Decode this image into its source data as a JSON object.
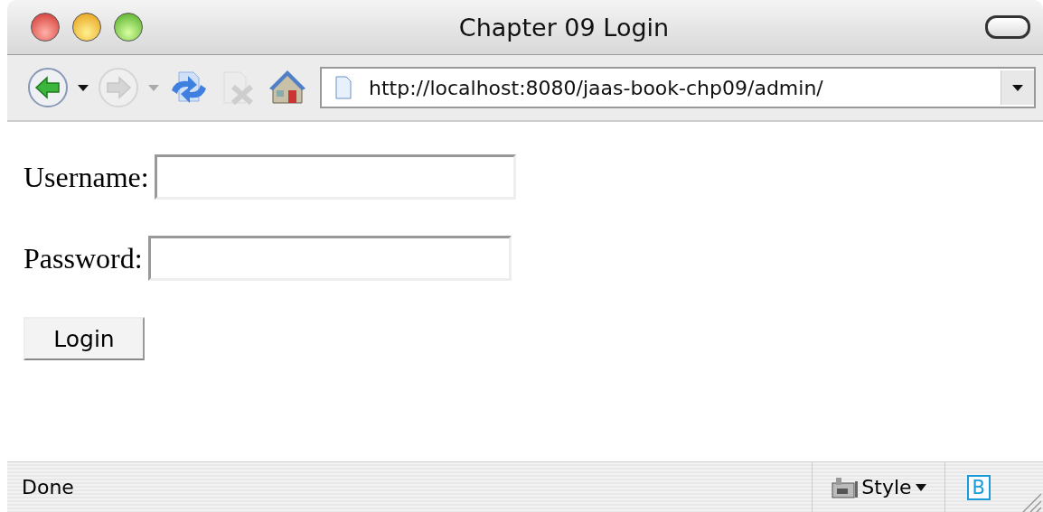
{
  "window": {
    "title": "Chapter 09 Login"
  },
  "toolbar": {
    "address": "http://localhost:8080/jaas-book-chp09/admin/",
    "back_disabled": false,
    "forward_disabled": true,
    "stop_disabled": true
  },
  "form": {
    "fields": [
      {
        "label": "Username:"
      },
      {
        "label": "Password:"
      }
    ],
    "submit": "Login"
  },
  "status_bar": {
    "text": "Done",
    "style_menu": "Style",
    "badge": "B"
  }
}
